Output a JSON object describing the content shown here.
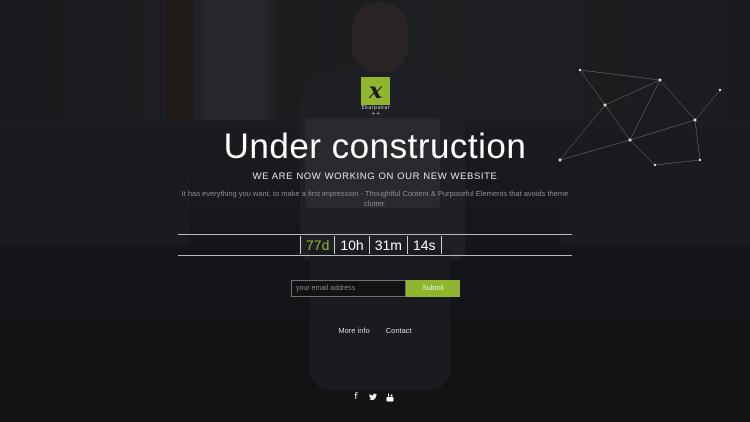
{
  "logo": {
    "mark": "x",
    "subtext": "Ekalpakar ++"
  },
  "hero": {
    "title": "Under construction",
    "subtitle": "WE ARE NOW WORKING ON OUR NEW WEBSITE",
    "description": "It has everything you want, to make a first impression - Thoughtful Content & Purposeful Elements that avoids theme clutter."
  },
  "countdown": {
    "days": "77d",
    "hours": "10h",
    "minutes": "31m",
    "seconds": "14s"
  },
  "subscribe": {
    "placeholder": "your email address",
    "button": "Submit"
  },
  "links": {
    "more_info": "More info",
    "contact": "Contact"
  },
  "social": [
    "facebook-icon",
    "twitter-icon",
    "youtube-icon"
  ],
  "colors": {
    "accent": "#8fb531",
    "text": "#ffffff"
  }
}
